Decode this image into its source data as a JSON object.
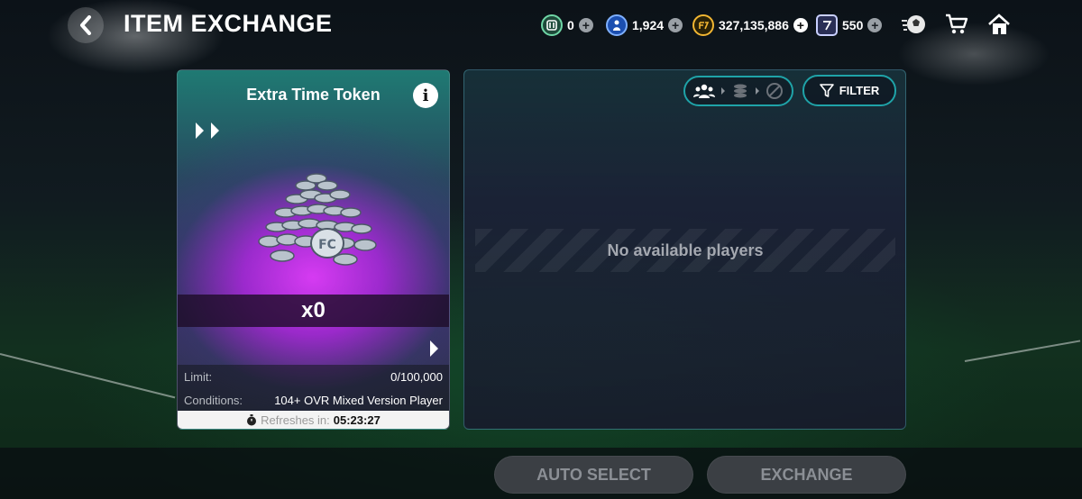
{
  "header": {
    "title": "ITEM EXCHANGE",
    "currencies": [
      {
        "name": "tokens",
        "value": "0",
        "icon": "trophy-token-icon"
      },
      {
        "name": "players",
        "value": "1,924",
        "icon": "player-icon"
      },
      {
        "name": "coins",
        "value": "327,135,886",
        "icon": "coin-icon"
      },
      {
        "name": "points",
        "value": "550",
        "icon": "points-icon"
      }
    ],
    "icons": [
      "ball-icon",
      "cart-icon",
      "home-icon"
    ]
  },
  "item": {
    "name": "Extra Time Token",
    "quantity": "x0",
    "limit_label": "Limit:",
    "limit_value": "0/100,000",
    "conditions_label": "Conditions:",
    "conditions_value": "104+ OVR Mixed Version Player",
    "refresh_label": "Refreshes in:",
    "refresh_time": "05:23:27"
  },
  "panel": {
    "filter_label": "FILTER",
    "empty_message": "No available players"
  },
  "actions": {
    "auto_select": "AUTO SELECT",
    "exchange": "EXCHANGE"
  },
  "colors": {
    "accent": "#1fa3a8",
    "card_purple": "#d63bf2",
    "coin_gold": "#f2b632",
    "disabled_button": "#3b3f44"
  }
}
